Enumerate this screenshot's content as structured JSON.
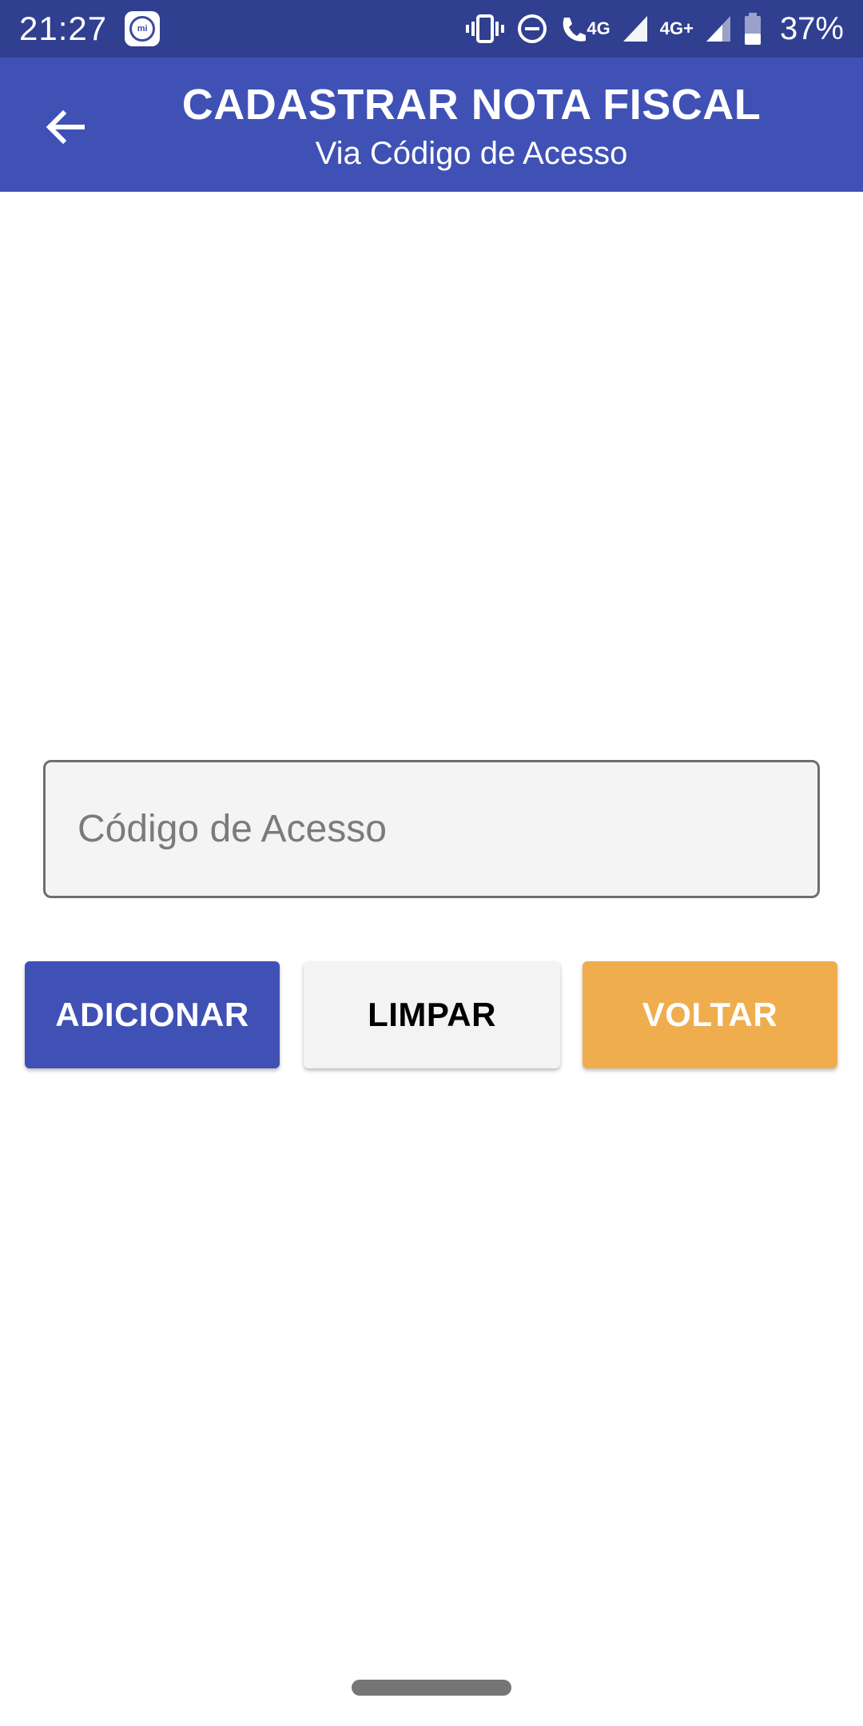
{
  "status_bar": {
    "time": "21:27",
    "network_1": "4G",
    "network_2": "4G+",
    "battery": "37%",
    "icons": [
      "mi-icon",
      "vibrate-icon",
      "dnd-icon",
      "call-icon",
      "signal-icon",
      "battery-icon"
    ]
  },
  "header": {
    "title": "CADASTRAR NOTA FISCAL",
    "subtitle": "Via Código de Acesso",
    "back_icon": "arrow-left-icon"
  },
  "form": {
    "access_code_value": "",
    "access_code_placeholder": "Código de Acesso"
  },
  "buttons": {
    "add_label": "ADICIONAR",
    "clear_label": "LIMPAR",
    "back_label": "VOLTAR"
  },
  "colors": {
    "status_bar": "#303f8f",
    "primary": "#3f51b5",
    "accent_orange": "#f0ad4e",
    "clear_button": "#f3f3f3"
  }
}
